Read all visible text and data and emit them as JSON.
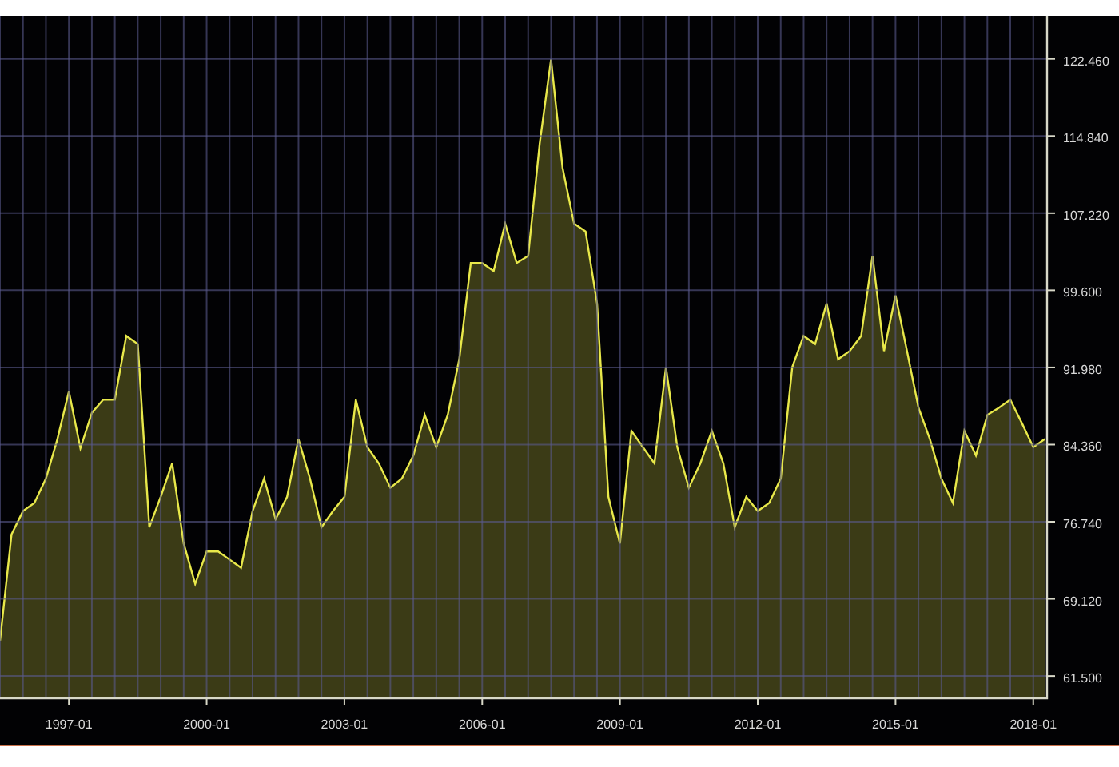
{
  "chart": {
    "chart_data": {
      "type": "area",
      "categories": [
        null,
        null,
        null,
        null,
        null,
        null,
        "1997-01",
        null,
        null,
        null,
        null,
        null,
        null,
        null,
        null,
        null,
        null,
        null,
        "2000-01",
        null,
        null,
        null,
        null,
        null,
        null,
        null,
        null,
        null,
        null,
        null,
        "2003-01",
        null,
        null,
        null,
        null,
        null,
        null,
        null,
        null,
        null,
        null,
        null,
        "2006-01",
        null,
        null,
        null,
        null,
        null,
        null,
        null,
        null,
        null,
        null,
        null,
        "2009-01",
        null,
        null,
        null,
        null,
        null,
        null,
        null,
        null,
        null,
        null,
        null,
        "2012-01",
        null,
        null,
        null,
        null,
        null,
        null,
        null,
        null,
        null,
        null,
        null,
        "2015-01",
        null,
        null,
        null,
        null,
        null,
        null,
        null,
        null,
        null,
        null,
        null,
        "2018-01",
        null
      ],
      "series": [
        {
          "color": "#e8e84a",
          "values": [
            65,
            75.5,
            77.8,
            78.6,
            81,
            84.9,
            89.6,
            84,
            87.5,
            88.8,
            88.8,
            95.1,
            94.3,
            76.2,
            79.2,
            82.5,
            74.6,
            70.6,
            73.8,
            73.8,
            73,
            72.2,
            77.8,
            81,
            77,
            79.2,
            84.9,
            81,
            76.2,
            77.8,
            79.2,
            88.8,
            84.1,
            82.5,
            80.1,
            81,
            83.3,
            87.3,
            84.1,
            87.3,
            92.8,
            102.3,
            102.3,
            101.5,
            106.2,
            102.3,
            103,
            114.1,
            122.4,
            111.7,
            106.2,
            105.4,
            98.3,
            79.2,
            74.6,
            85.7,
            84.1,
            82.5,
            92,
            84.1,
            80.1,
            82.5,
            85.7,
            82.5,
            76.2,
            79.2,
            77.8,
            78.6,
            81,
            92,
            95.1,
            94.3,
            98.3,
            92.8,
            93.6,
            95.1,
            103,
            93.6,
            99.1,
            93.6,
            88,
            84.9,
            81,
            78.6,
            85.7,
            83.3,
            87.3,
            88,
            88.8,
            86.5,
            84.1,
            84.9
          ]
        }
      ],
      "ylim": [
        59.3,
        126.7
      ],
      "grid": true,
      "yticks": [
        {
          "value": 61.5,
          "label": "61.500"
        },
        {
          "value": 69.12,
          "label": "69.120"
        },
        {
          "value": 76.74,
          "label": "76.740"
        },
        {
          "value": 84.36,
          "label": "84.360"
        },
        {
          "value": 91.98,
          "label": "91.980"
        },
        {
          "value": 99.6,
          "label": "99.600"
        },
        {
          "value": 107.22,
          "label": "107.220"
        },
        {
          "value": 114.84,
          "label": "114.840"
        },
        {
          "value": 122.46,
          "label": "122.460"
        }
      ]
    }
  }
}
